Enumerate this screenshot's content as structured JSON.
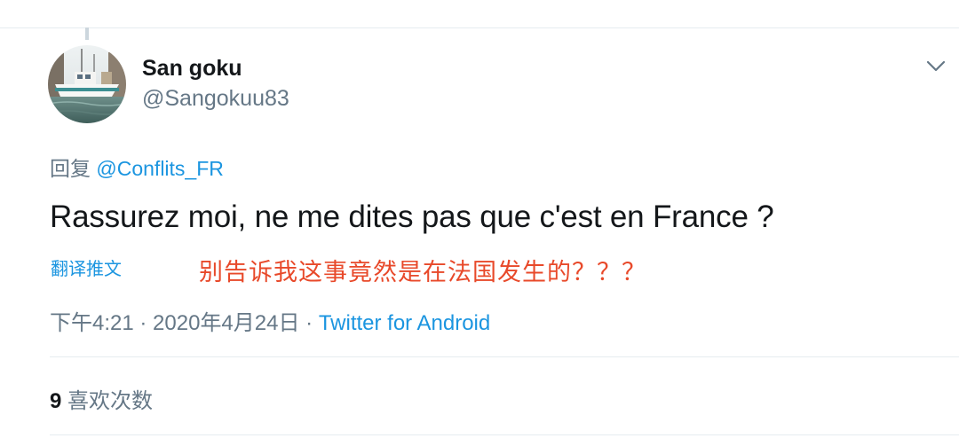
{
  "tweet": {
    "author": {
      "display_name": "San goku",
      "handle": "@Sangokuu83"
    },
    "reply_prefix": "回复",
    "reply_mention": "@Conflits_FR",
    "text": "Rassurez moi, ne me dites pas que c'est en France ?",
    "translate_label": "翻译推文",
    "annotation": "别告诉我这事竟然是在法国发生的？？？",
    "time": "下午4:21",
    "separator": " · ",
    "date": "2020年4月24日",
    "source": "Twitter for Android",
    "likes_count": "9",
    "likes_label": "喜欢次数"
  },
  "icons": {
    "caret": "chevron-down-icon",
    "avatar": "boat-harbor-photo"
  },
  "colors": {
    "link": "#1b95e0",
    "secondary_text": "#657786",
    "primary_text": "#14171a",
    "annotation": "#e8492a",
    "divider": "#e6ecf0"
  }
}
